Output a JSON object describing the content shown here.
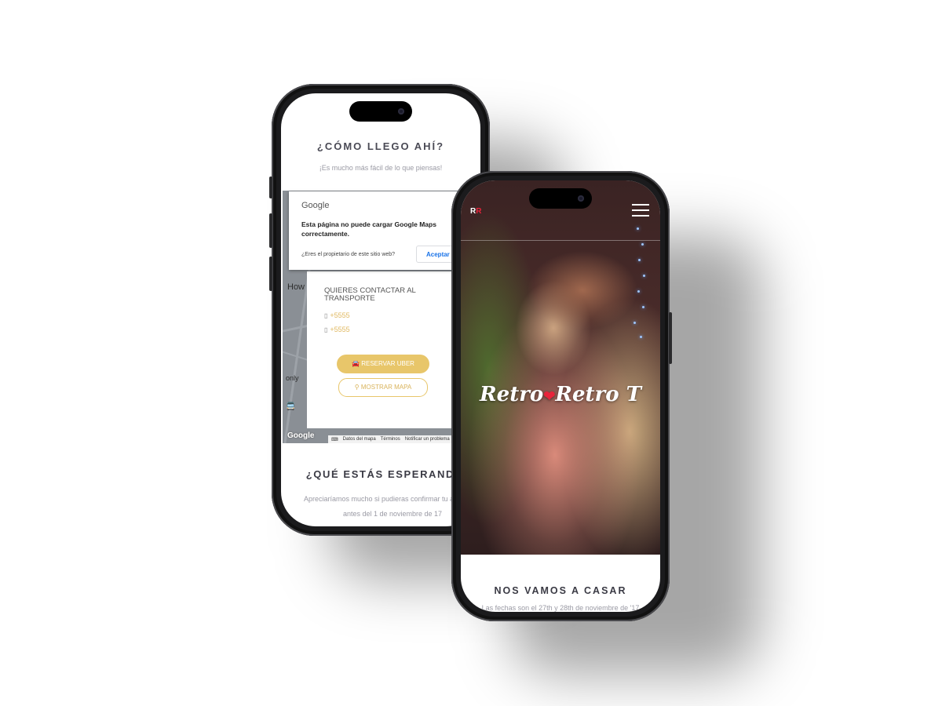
{
  "phone_left": {
    "section_title": "¿CÓMO LLEGO AHÍ?",
    "section_subtitle": "¡Es mucho más fácil de lo que piensas!",
    "map": {
      "provider_name": "Google",
      "error_message": "Esta página no puede cargar Google Maps correctamente.",
      "owner_question": "¿Eres el propietario de este sitio web?",
      "accept_button": "Aceptar",
      "place_label": "How",
      "only_label": "only",
      "logo_text": "Google",
      "footer": [
        "Datos del mapa",
        "Términos",
        "Notificar un problema"
      ]
    },
    "transport_card": {
      "title": "QUIERES CONTACTAR AL TRANSPORTE",
      "phones": [
        "+5555",
        "+5555"
      ],
      "uber_button": "RESERVAR UBER",
      "map_button": "MOSTRAR MAPA"
    },
    "next_title": "¿QUÉ ESTÁS ESPERANDO?",
    "next_text": "Apreciaríamos mucho si pudieras confirmar tu asistencia antes del 1 de noviembre de 17"
  },
  "phone_right": {
    "logo": {
      "left": "R",
      "right": "R"
    },
    "brand_name_part1": "Retro",
    "brand_name_part2": "Retro T",
    "section_title": "NOS VAMOS A CASAR",
    "section_text": "Las fechas son el 27th y 28th de noviembre de '17"
  },
  "colors": {
    "accent_gold": "#e8c66a",
    "heart_red": "#e8233a",
    "heading_text": "#3a3a44"
  }
}
